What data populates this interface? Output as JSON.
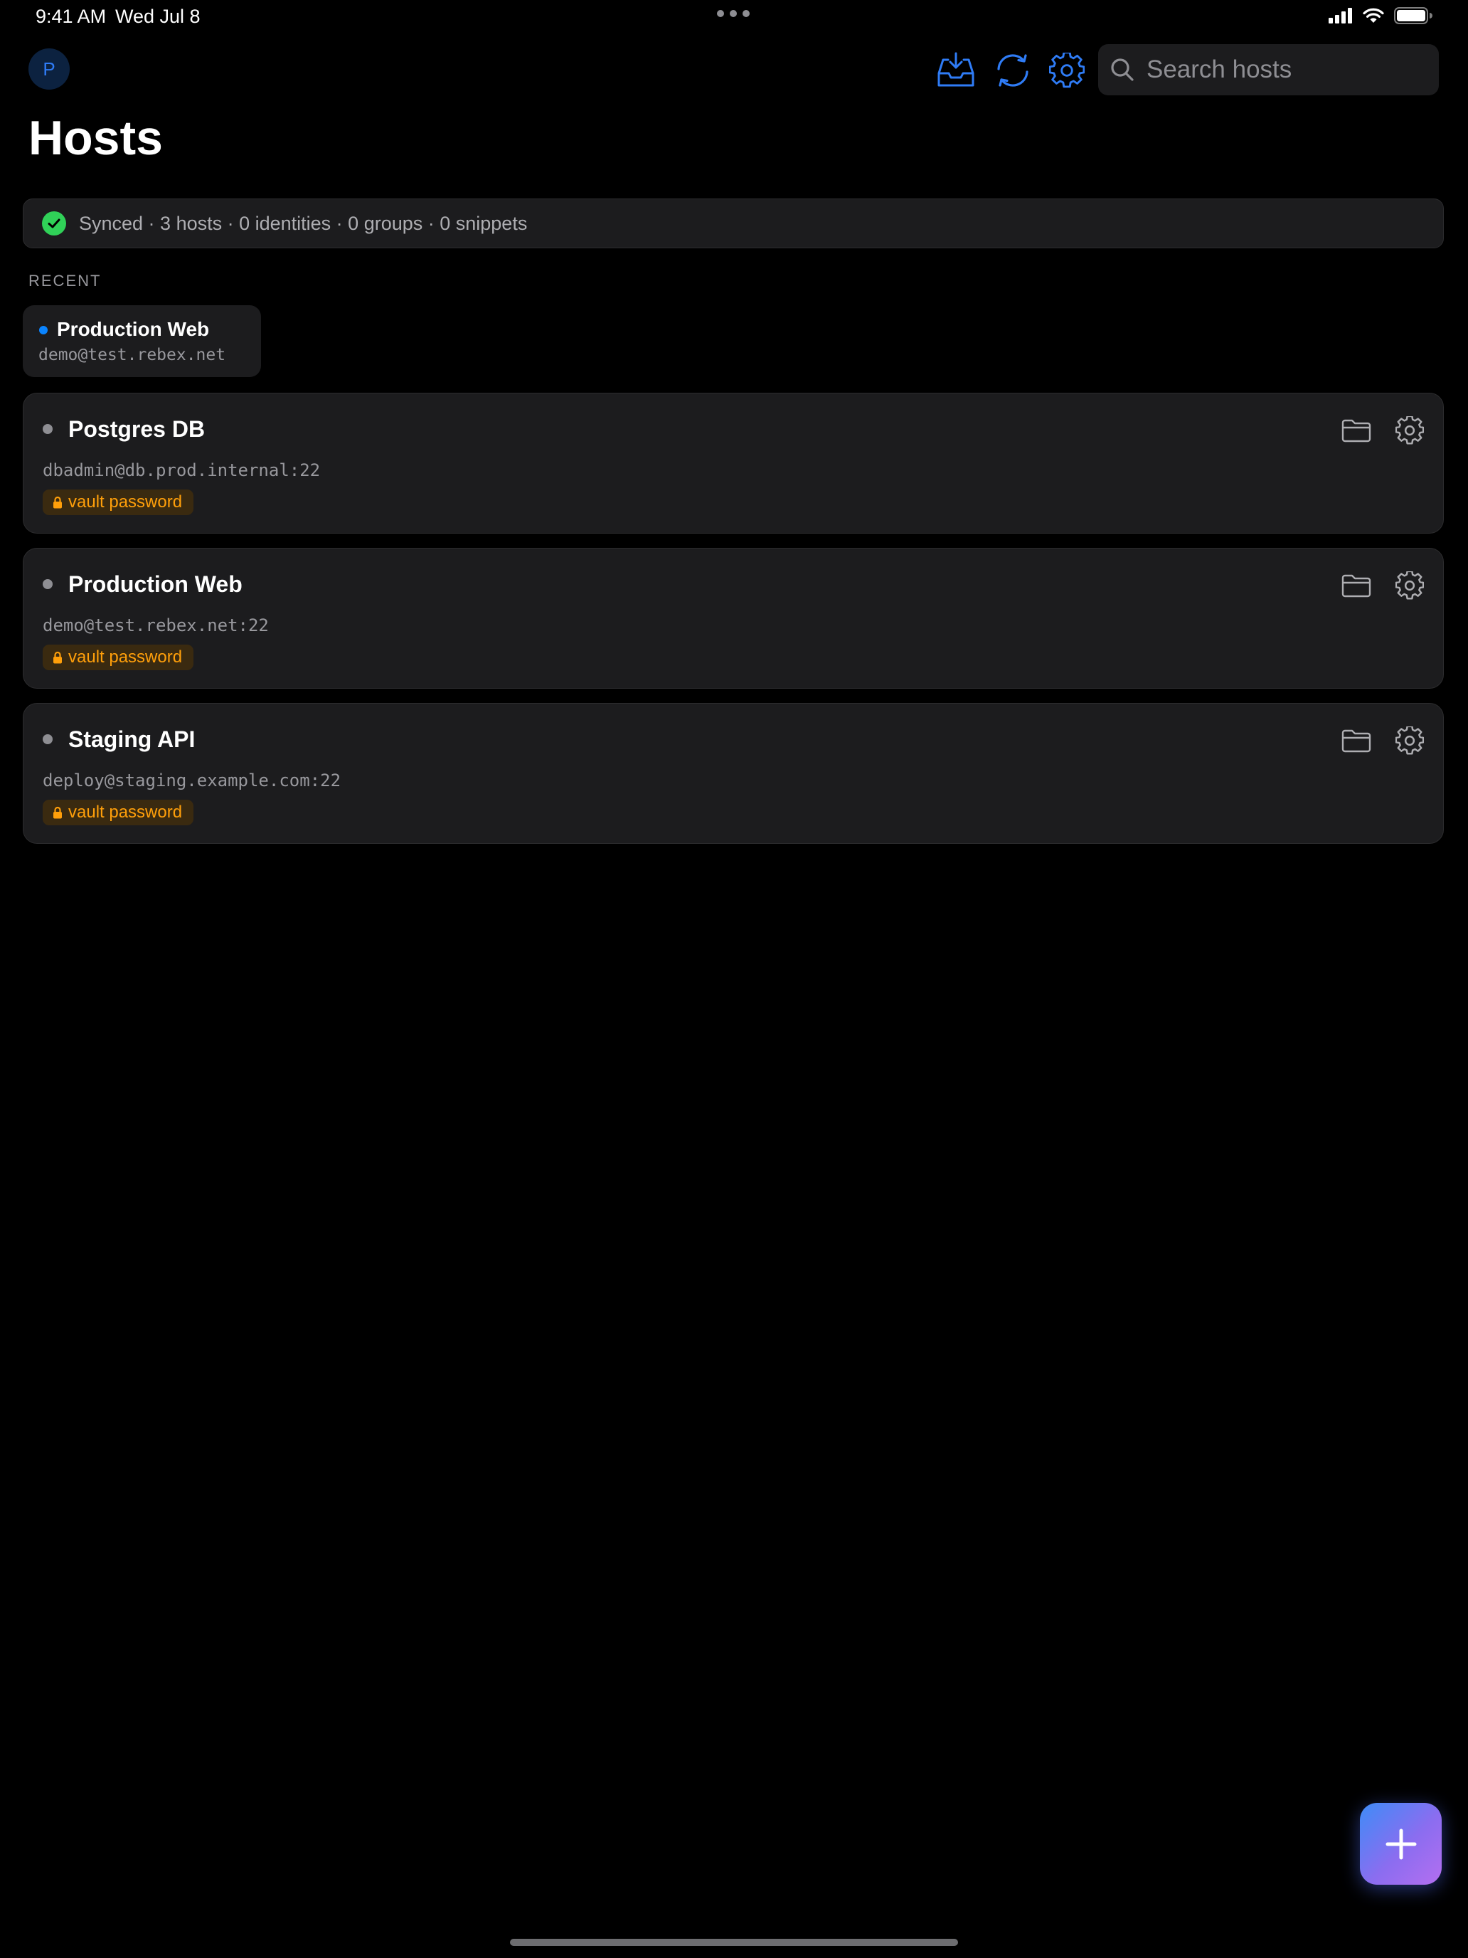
{
  "status_bar": {
    "time": "9:41 AM",
    "date": "Wed Jul 8",
    "icons": [
      "cellular-icon",
      "wifi-icon",
      "battery-icon"
    ]
  },
  "header": {
    "avatar_initial": "P",
    "title": "Hosts",
    "toolbar_icons": [
      "inbox-download-icon",
      "sync-icon",
      "gear-icon"
    ],
    "search_placeholder": "Search hosts",
    "accent_color": "#2f7cf6"
  },
  "sync_banner": {
    "text": "Synced · 3 hosts · 0 identities · 0 groups · 0 snippets",
    "status_color": "#30d158"
  },
  "recent": {
    "section_label": "RECENT",
    "items": [
      {
        "name": "Production Web",
        "address": "demo@test.rebex.net",
        "status_color": "#0a84ff"
      }
    ]
  },
  "hosts": [
    {
      "name": "Postgres DB",
      "address": "dbadmin@db.prod.internal:22",
      "badge": "vault password"
    },
    {
      "name": "Production Web",
      "address": "demo@test.rebex.net:22",
      "badge": "vault password"
    },
    {
      "name": "Staging API",
      "address": "deploy@staging.example.com:22",
      "badge": "vault password"
    }
  ],
  "fab": {
    "icon": "plus-icon"
  },
  "colors": {
    "background": "#000000",
    "card": "#1c1c1e",
    "badge_text": "#ff9f0a",
    "badge_bg": "#3a2a10"
  }
}
